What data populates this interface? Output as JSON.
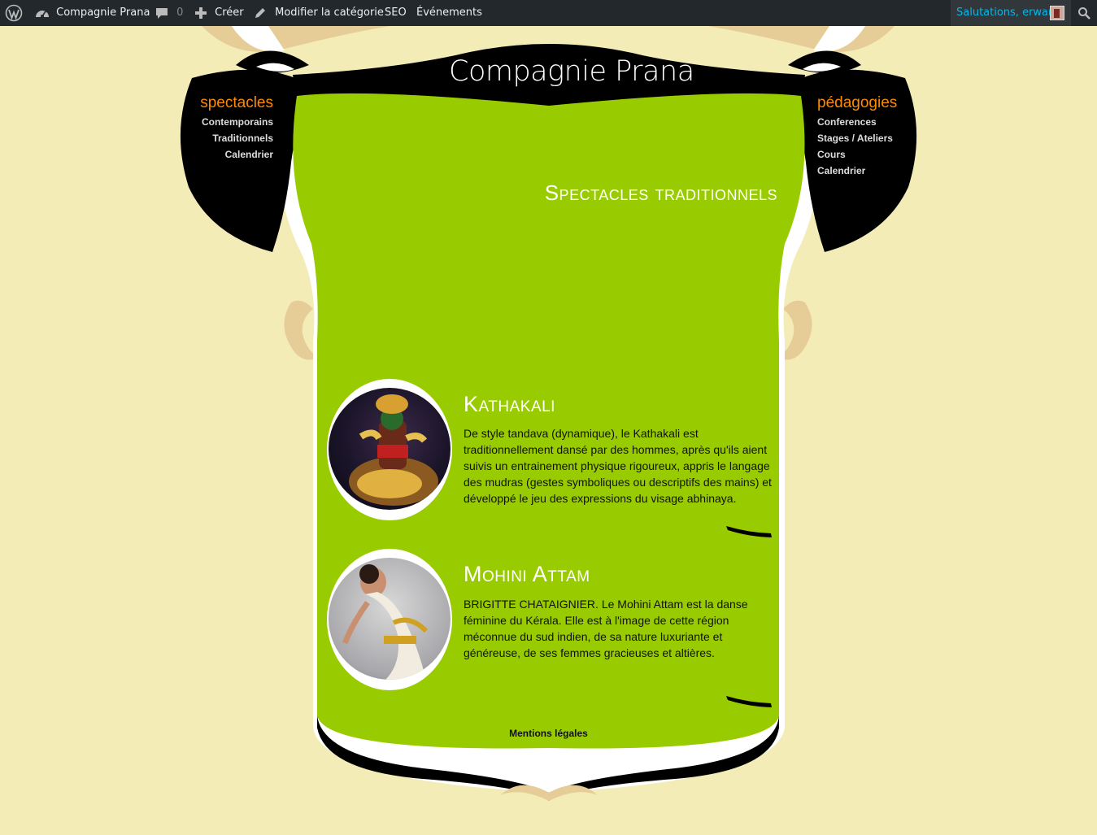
{
  "adminbar": {
    "site_name": "Compagnie Prana",
    "comments_count": "0",
    "create_label": "Créer",
    "edit_label": "Modifier la catégorie",
    "seo_label": "SEO",
    "events_label": "Événements",
    "greeting": "Salutations, erwan"
  },
  "logo_text": "Compagnie Prana",
  "left_menu": {
    "title": "spectacles",
    "items": [
      "Contemporains",
      "Traditionnels",
      "Calendrier"
    ]
  },
  "right_menu": {
    "title": "pédagogies",
    "items": [
      "Conferences",
      "Stages / Ateliers",
      "Cours",
      "Calendrier"
    ]
  },
  "page_title": "Spectacles traditionnels",
  "entries": [
    {
      "title": "Kathakali",
      "text": "De style tandava (dynamique), le Kathakali est traditionnellement dansé par des hommes, après qu'ils aient suivis un entrainement physique rigoureux, appris le langage des mudras (gestes symboliques ou descriptifs des mains) et développé le jeu des expressions du visage abhinaya."
    },
    {
      "title": "Mohini Attam",
      "text": "BRIGITTE CHATAIGNIER. Le Mohini Attam est la danse féminine du Kérala. Elle est à l'image de cette région méconnue du sud indien, de sa nature luxuriante et généreuse, de ses femmes gracieuses et altières."
    }
  ],
  "footer_link": "Mentions légales",
  "colors": {
    "background": "#f3ecb6",
    "panel_green": "#99cc00",
    "menu_orange": "#ff8a00",
    "frame_black": "#000000",
    "admin_bar": "#23282d",
    "greeting_blue": "#00b9eb"
  }
}
